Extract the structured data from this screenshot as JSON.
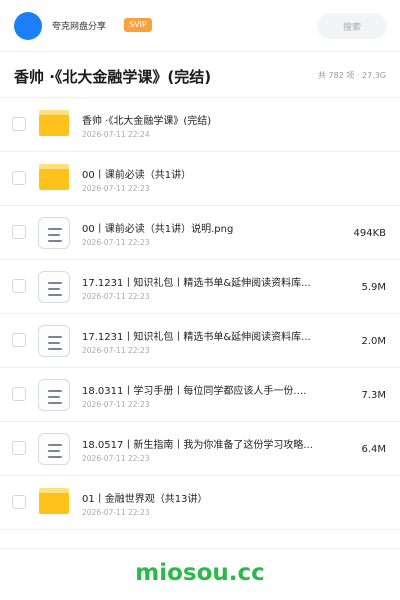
{
  "header": {
    "app_name": "夸克网盘分享",
    "badge": "SVIP",
    "search_placeholder": "搜索",
    "avatar_color": "#1e7ef7",
    "badge_color": "#f7a23b"
  },
  "folder": {
    "title": "香帅 ·《北大金融学课》(完结)",
    "meta": "共 782 项 · 27.3G"
  },
  "files": [
    {
      "type": "folder",
      "icon": "folder-icon",
      "name": "香帅 ·《北大金融学课》(完结)",
      "date": "2026-07-11 22:24",
      "size": ""
    },
    {
      "type": "folder",
      "icon": "folder-icon",
      "name": "00丨课前必读（共1讲）",
      "date": "2026-07-11 22:23",
      "size": ""
    },
    {
      "type": "file",
      "icon": "document-icon",
      "name": "00丨课前必读（共1讲）说明.png",
      "date": "2026-07-11 22:23",
      "size": "494KB"
    },
    {
      "type": "file",
      "icon": "document-icon",
      "name": "17.1231丨知识礼包丨精选书单&延伸阅读资料库...",
      "date": "2026-07-11 22:23",
      "size": "5.9M"
    },
    {
      "type": "file",
      "icon": "document-icon",
      "name": "17.1231丨知识礼包丨精选书单&延伸阅读资料库...",
      "date": "2026-07-11 22:23",
      "size": "2.0M"
    },
    {
      "type": "file",
      "icon": "document-icon",
      "name": "18.0311丨学习手册丨每位同学都应该人手一份.…",
      "date": "2026-07-11 22:23",
      "size": "7.3M"
    },
    {
      "type": "file",
      "icon": "document-icon",
      "name": "18.0517丨新生指南丨我为你准备了这份学习攻略...",
      "date": "2026-07-11 22:23",
      "size": "6.4M"
    },
    {
      "type": "folder",
      "icon": "folder-icon",
      "name": "01丨金融世界观（共13讲）",
      "date": "2026-07-11 22:23",
      "size": ""
    }
  ],
  "watermark": "miosou.cc",
  "watermark_color": "#2db84c"
}
